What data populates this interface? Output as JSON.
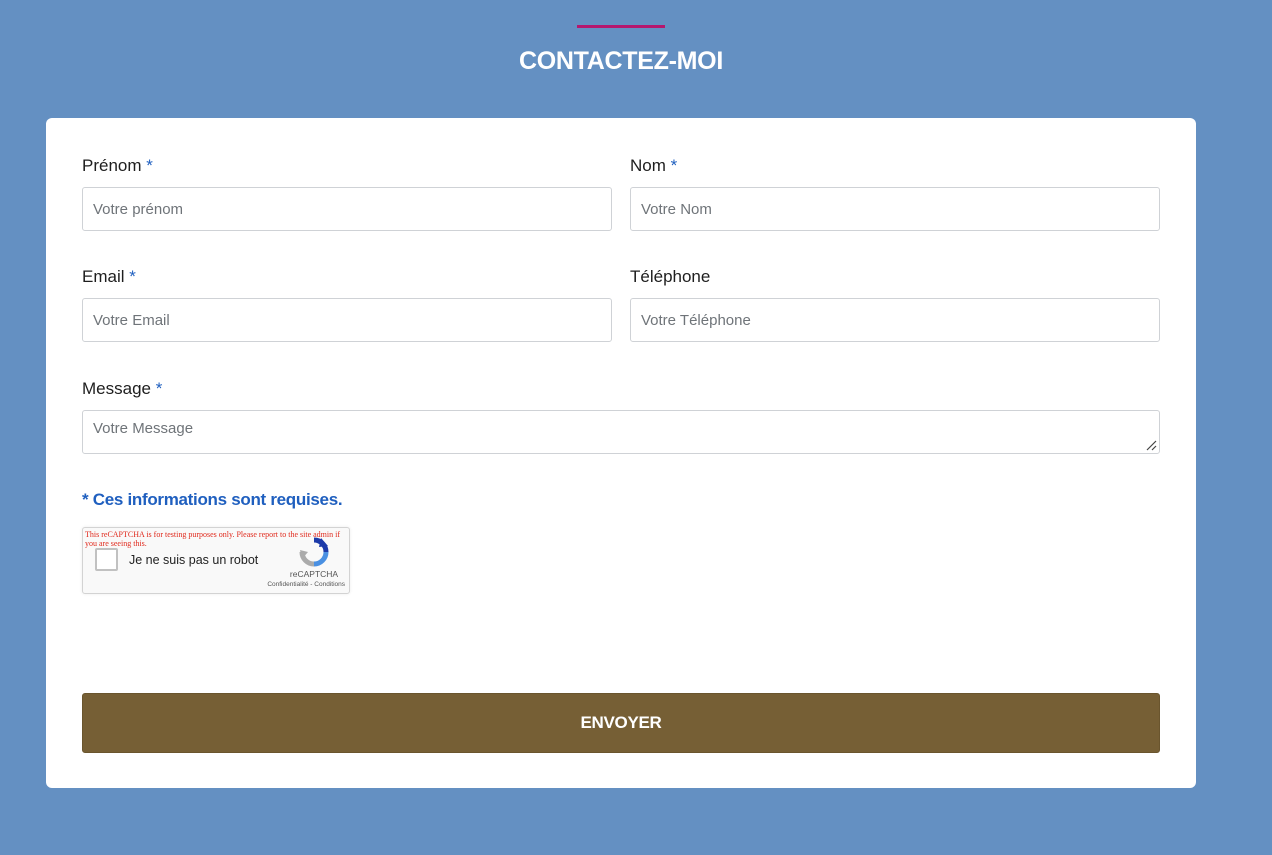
{
  "header": {
    "title": "CONTACTEZ-MOI"
  },
  "form": {
    "required_marker": "*",
    "fields": {
      "prenom": {
        "label": "Prénom",
        "placeholder": "Votre prénom",
        "required": true
      },
      "nom": {
        "label": "Nom",
        "placeholder": "Votre Nom",
        "required": true
      },
      "email": {
        "label": "Email",
        "placeholder": "Votre Email",
        "required": true
      },
      "telephone": {
        "label": "Téléphone",
        "placeholder": "Votre Téléphone",
        "required": false
      },
      "message": {
        "label": "Message",
        "placeholder": "Votre Message",
        "required": true
      }
    },
    "required_note": "* Ces informations sont requises.",
    "captcha": {
      "warning": "This reCAPTCHA is for testing purposes only. Please report to the site admin if you are seeing this.",
      "label": "Je ne suis pas un robot",
      "brand": "reCAPTCHA",
      "links": "Confidentialité - Conditions"
    },
    "submit_label": "ENVOYER"
  },
  "colors": {
    "background": "#6490c2",
    "accent_bar": "#b5176e",
    "required": "#1f5fbf",
    "button": "#765f35",
    "captcha_warning": "#e0291c"
  }
}
